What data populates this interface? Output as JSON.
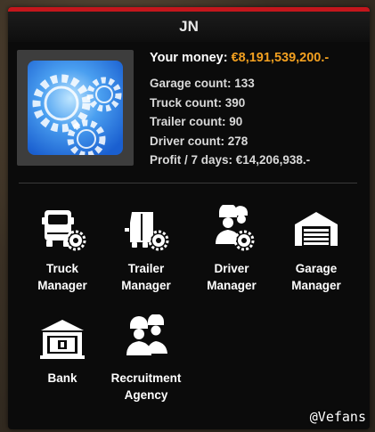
{
  "company": {
    "name": "JN"
  },
  "stats": {
    "money_label": "Your money:",
    "money_value": "€8,191,539,200.-",
    "garage": "Garage count: 133",
    "truck": "Truck count: 390",
    "trailer": "Trailer count: 90",
    "driver": "Driver count: 278",
    "profit": "Profit / 7 days: €14,206,938.-"
  },
  "menu": [
    {
      "line1": "Truck",
      "line2": "Manager",
      "icon": "truck-gear-icon"
    },
    {
      "line1": "Trailer",
      "line2": "Manager",
      "icon": "trailer-gear-icon"
    },
    {
      "line1": "Driver",
      "line2": "Manager",
      "icon": "driver-gear-icon"
    },
    {
      "line1": "Garage",
      "line2": "Manager",
      "icon": "garage-icon"
    },
    {
      "line1": "Bank",
      "line2": "",
      "icon": "bank-icon"
    },
    {
      "line1": "Recruitment",
      "line2": "Agency",
      "icon": "recruitment-icon"
    }
  ],
  "watermark": "@Vefans",
  "colors": {
    "accent_bar": "#c4161c",
    "money": "#f2a020",
    "panel": "#0b0b0b"
  }
}
